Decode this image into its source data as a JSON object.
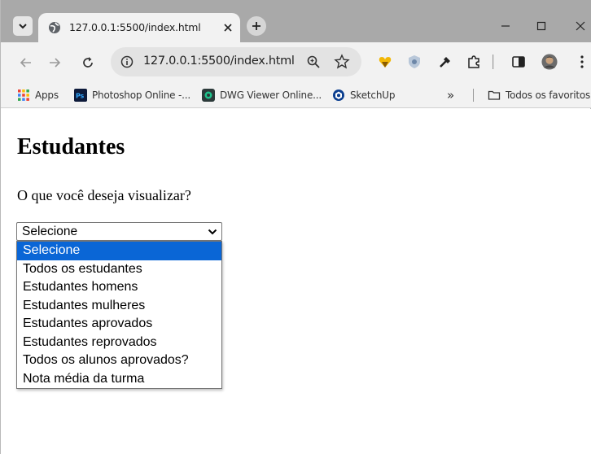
{
  "browser": {
    "tab_title": "127.0.0.1:5500/index.html",
    "url": "127.0.0.1:5500/index.html",
    "bookmarks": [
      {
        "label": "Apps",
        "icon": "apps-grid-icon"
      },
      {
        "label": "Photoshop Online -...",
        "icon": "photoshop-icon"
      },
      {
        "label": "DWG Viewer Online...",
        "icon": "dwg-viewer-icon"
      },
      {
        "label": "SketchUp",
        "icon": "sketchup-icon"
      }
    ],
    "bookmarks_overflow": "»",
    "all_bookmarks_label": "Todos os favoritos"
  },
  "page": {
    "title": "Estudantes",
    "question": "O que você deseja visualizar?",
    "select": {
      "value": "Selecione",
      "options": [
        "Selecione",
        "Todos os estudantes",
        "Estudantes homens",
        "Estudantes mulheres",
        "Estudantes aprovados",
        "Estudantes reprovados",
        "Todos os alunos aprovados?",
        "Nota média da turma"
      ],
      "highlighted_index": 0
    }
  },
  "colors": {
    "tabstrip": "#a9a9a9",
    "toolbar": "#f2f2f2",
    "highlight": "#0a66d6"
  }
}
